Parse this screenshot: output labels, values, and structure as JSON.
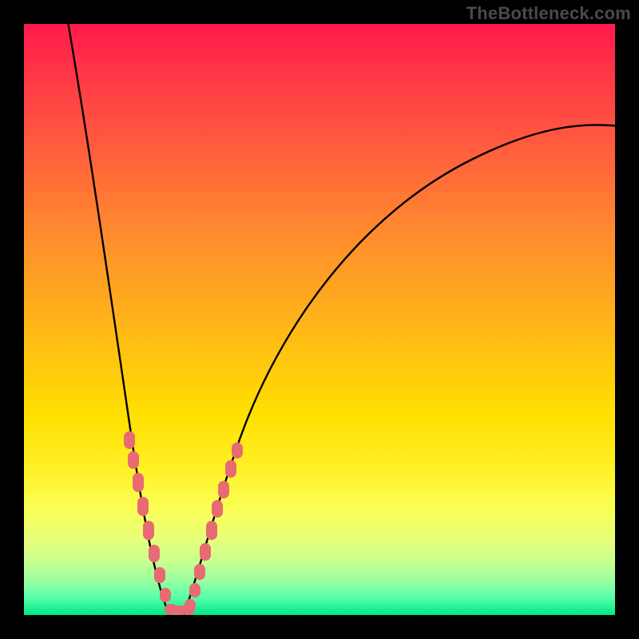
{
  "watermark": {
    "text": "TheBottleneck.com"
  },
  "chart_data": {
    "type": "line",
    "title": "",
    "xlabel": "",
    "ylabel": "",
    "xlim": [
      0,
      100
    ],
    "ylim": [
      0,
      100
    ],
    "grid": false,
    "legend": false,
    "gradient_stops": [
      {
        "pct": 0,
        "color": "#ff1a4b"
      },
      {
        "pct": 8,
        "color": "#ff3547"
      },
      {
        "pct": 20,
        "color": "#ff5a3f"
      },
      {
        "pct": 35,
        "color": "#ff8a2e"
      },
      {
        "pct": 50,
        "color": "#ffb31a"
      },
      {
        "pct": 66,
        "color": "#ffe000"
      },
      {
        "pct": 76,
        "color": "#fff22a"
      },
      {
        "pct": 82,
        "color": "#faff55"
      },
      {
        "pct": 87,
        "color": "#e8ff7a"
      },
      {
        "pct": 91,
        "color": "#c8ff90"
      },
      {
        "pct": 94,
        "color": "#9cffa0"
      },
      {
        "pct": 97,
        "color": "#5affac"
      },
      {
        "pct": 100,
        "color": "#00e887"
      }
    ],
    "series": [
      {
        "name": "left_branch",
        "x": [
          7,
          9,
          11,
          13,
          15,
          17,
          18.5,
          20,
          21.5,
          23,
          24
        ],
        "y": [
          100,
          87,
          74,
          61,
          47,
          34,
          25,
          16,
          9,
          3,
          0
        ]
      },
      {
        "name": "right_branch",
        "x": [
          27,
          28.5,
          30,
          32,
          35,
          40,
          47,
          56,
          66,
          77,
          88,
          100
        ],
        "y": [
          0,
          3,
          8,
          14,
          22,
          34,
          46,
          57,
          66,
          73,
          78,
          82
        ]
      }
    ],
    "marker_clusters": [
      {
        "series": "left_branch",
        "points": [
          {
            "x": 17.5,
            "y": 30
          },
          {
            "x": 18.0,
            "y": 27
          },
          {
            "x": 18.8,
            "y": 22
          },
          {
            "x": 19.4,
            "y": 18
          },
          {
            "x": 20.2,
            "y": 13
          },
          {
            "x": 21.0,
            "y": 9
          },
          {
            "x": 22.0,
            "y": 5
          },
          {
            "x": 23.0,
            "y": 2
          }
        ]
      },
      {
        "series": "right_branch",
        "points": [
          {
            "x": 27.5,
            "y": 1
          },
          {
            "x": 28.3,
            "y": 3
          },
          {
            "x": 29.0,
            "y": 6
          },
          {
            "x": 30.0,
            "y": 9
          },
          {
            "x": 31.2,
            "y": 13
          },
          {
            "x": 32.0,
            "y": 16
          },
          {
            "x": 33.0,
            "y": 19
          },
          {
            "x": 34.5,
            "y": 23
          },
          {
            "x": 35.5,
            "y": 25
          }
        ]
      },
      {
        "series": "trough",
        "points": [
          {
            "x": 24.0,
            "y": 0
          },
          {
            "x": 25.5,
            "y": 0
          },
          {
            "x": 27.0,
            "y": 0
          }
        ]
      }
    ],
    "marker_style": {
      "color": "#e86a72",
      "shape": "rounded-rect"
    }
  }
}
